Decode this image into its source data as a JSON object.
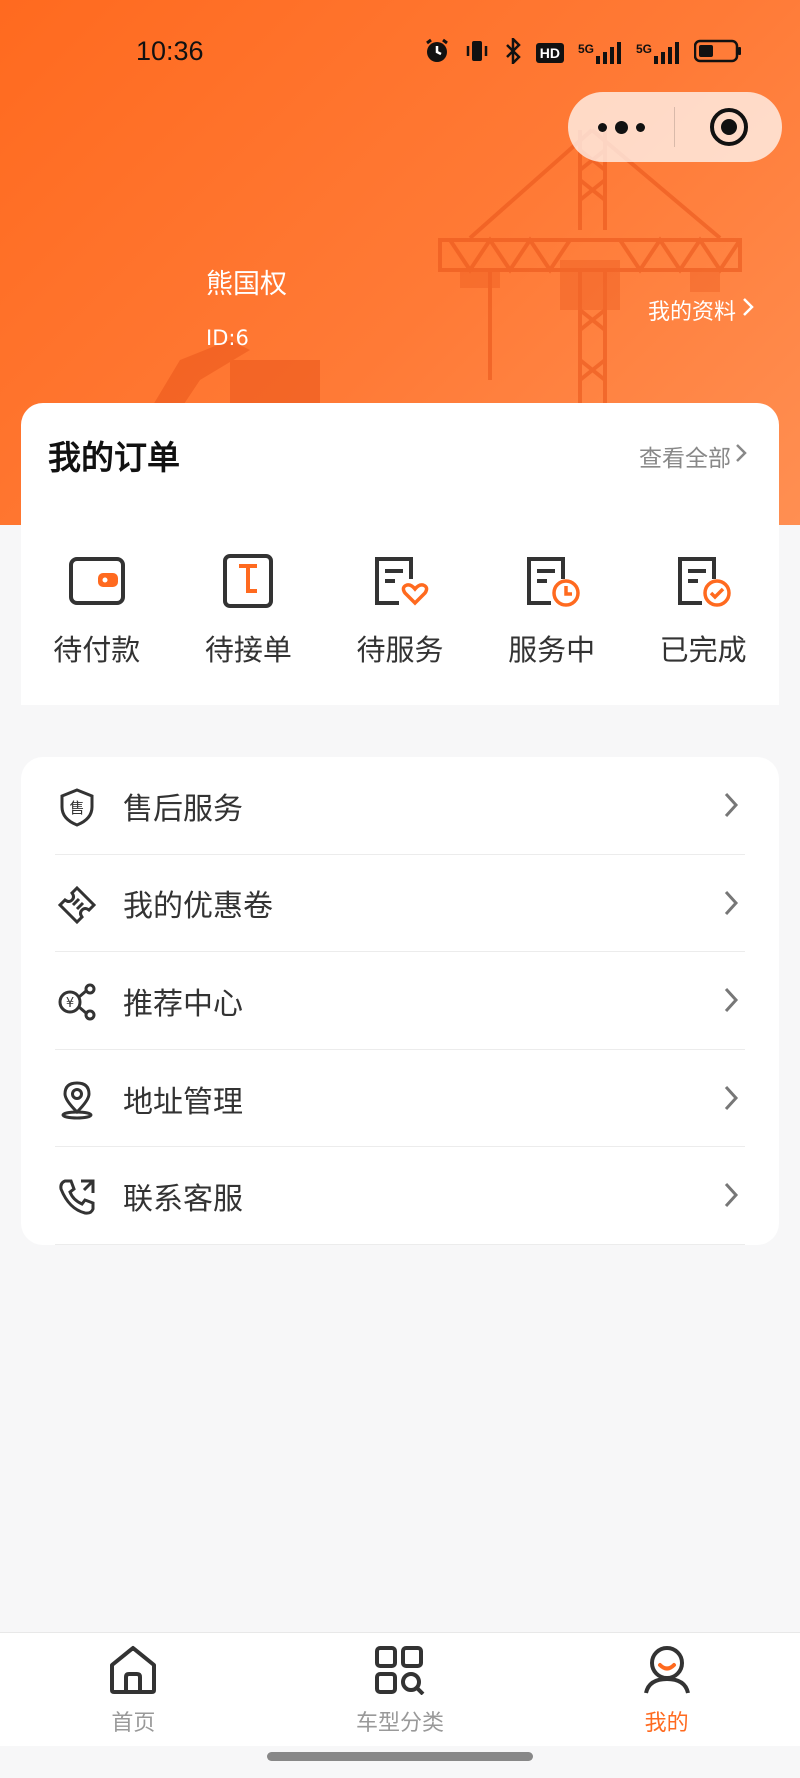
{
  "status_bar": {
    "time": "10:36",
    "icons": [
      "alarm-icon",
      "vibrate-icon",
      "bluetooth-icon",
      "hd-icon",
      "signal-5g-icon",
      "signal-5g-icon",
      "battery-icon"
    ],
    "hd_text": "HD",
    "net1": "5G",
    "net2": "5G"
  },
  "capsule": {
    "more_icon": "more-dots-icon",
    "target_icon": "target-icon"
  },
  "profile": {
    "name": "熊国权",
    "id": "ID:6",
    "link_label": "我的资料"
  },
  "orders": {
    "title": "我的订单",
    "view_all": "查看全部",
    "items": [
      {
        "label": "待付款",
        "icon": "wallet-icon"
      },
      {
        "label": "待接单",
        "icon": "calendar-icon"
      },
      {
        "label": "待服务",
        "icon": "document-heart-icon"
      },
      {
        "label": "服务中",
        "icon": "document-clock-icon"
      },
      {
        "label": "已完成",
        "icon": "document-check-icon"
      }
    ]
  },
  "menu": {
    "items": [
      {
        "label": "售后服务",
        "icon": "after-sales-shield-icon",
        "glyph": "售"
      },
      {
        "label": "我的优惠卷",
        "icon": "coupon-icon"
      },
      {
        "label": "推荐中心",
        "icon": "share-yuan-icon",
        "glyph": "¥"
      },
      {
        "label": "地址管理",
        "icon": "location-pin-icon"
      },
      {
        "label": "联系客服",
        "icon": "phone-icon"
      }
    ]
  },
  "tabbar": {
    "tabs": [
      {
        "label": "首页",
        "icon": "home-icon",
        "active": false
      },
      {
        "label": "车型分类",
        "icon": "category-grid-icon",
        "active": false
      },
      {
        "label": "我的",
        "icon": "user-icon",
        "active": true
      }
    ]
  },
  "colors": {
    "accent": "#ff6a1f",
    "header_start": "#ff6a1f",
    "header_end": "#ff8f52",
    "text": "#333333",
    "muted": "#999999"
  }
}
